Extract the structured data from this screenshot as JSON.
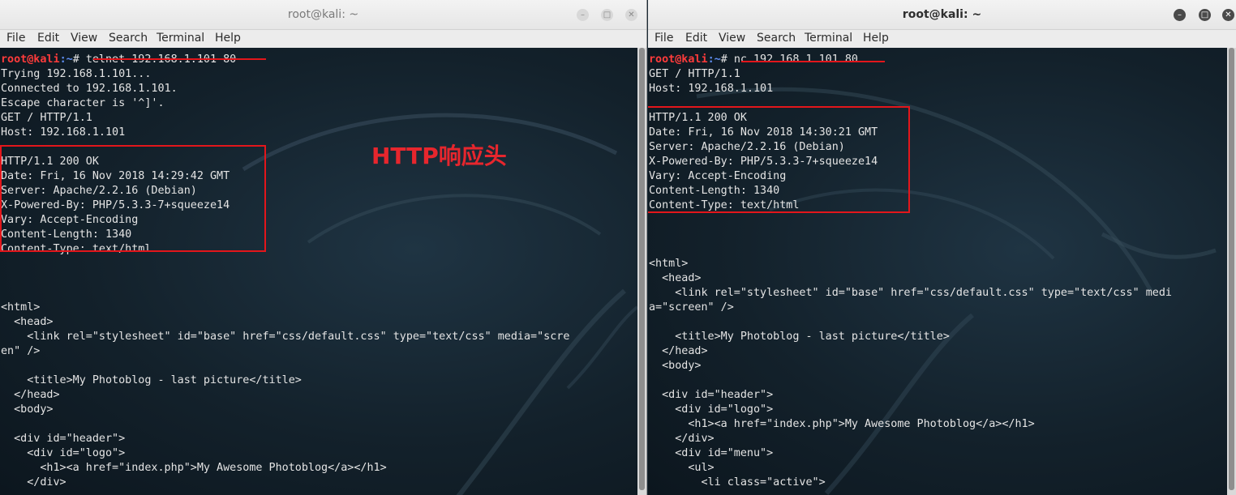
{
  "colors": {
    "prompt_user": "#ff3b3b",
    "prompt_path": "#5f8ff5",
    "highlight": "#e3161b",
    "terminal_text": "#e4e4e4"
  },
  "left": {
    "title": "root@kali: ~",
    "window_buttons": [
      "–",
      "□",
      "✕"
    ],
    "menu": [
      "File",
      "Edit",
      "View",
      "Search",
      "Terminal",
      "Help"
    ],
    "prompt": {
      "user": "root@kali",
      "path": ":~",
      "symbol": "# ",
      "command": "telnet 192.168.1.101 80"
    },
    "lines": [
      "Trying 192.168.1.101...",
      "Connected to 192.168.1.101.",
      "Escape character is '^]'.",
      "GET / HTTP/1.1",
      "Host: 192.168.1.101",
      "",
      "HTTP/1.1 200 OK",
      "Date: Fri, 16 Nov 2018 14:29:42 GMT",
      "Server: Apache/2.2.16 (Debian)",
      "X-Powered-By: PHP/5.3.3-7+squeeze14",
      "Vary: Accept-Encoding",
      "Content-Length: 1340",
      "Content-Type: text/html",
      "",
      "",
      "",
      "<html>",
      "  <head>",
      "    <link rel=\"stylesheet\" id=\"base\" href=\"css/default.css\" type=\"text/css\" media=\"scre",
      "en\" />",
      "",
      "    <title>My Photoblog - last picture</title>",
      "  </head>",
      "  <body>",
      "",
      "  <div id=\"header\">",
      "    <div id=\"logo\">",
      "      <h1><a href=\"index.php\">My Awesome Photoblog</a></h1>",
      "    </div>"
    ]
  },
  "right": {
    "title": "root@kali: ~",
    "window_buttons": [
      "–",
      "□",
      "✕"
    ],
    "menu": [
      "File",
      "Edit",
      "View",
      "Search",
      "Terminal",
      "Help"
    ],
    "prompt": {
      "user": "root@kali",
      "path": ":~",
      "symbol": "# ",
      "command": "nc 192.168.1.101 80"
    },
    "lines": [
      "GET / HTTP/1.1",
      "Host: 192.168.1.101",
      "",
      "HTTP/1.1 200 OK",
      "Date: Fri, 16 Nov 2018 14:30:21 GMT",
      "Server: Apache/2.2.16 (Debian)",
      "X-Powered-By: PHP/5.3.3-7+squeeze14",
      "Vary: Accept-Encoding",
      "Content-Length: 1340",
      "Content-Type: text/html",
      "",
      "",
      "",
      "<html>",
      "  <head>",
      "    <link rel=\"stylesheet\" id=\"base\" href=\"css/default.css\" type=\"text/css\" medi",
      "a=\"screen\" />",
      "",
      "    <title>My Photoblog - last picture</title>",
      "  </head>",
      "  <body>",
      "",
      "  <div id=\"header\">",
      "    <div id=\"logo\">",
      "      <h1><a href=\"index.php\">My Awesome Photoblog</a></h1>",
      "    </div>",
      "    <div id=\"menu\">",
      "      <ul>",
      "        <li class=\"active\">"
    ]
  },
  "annotation": "HTTP响应头"
}
